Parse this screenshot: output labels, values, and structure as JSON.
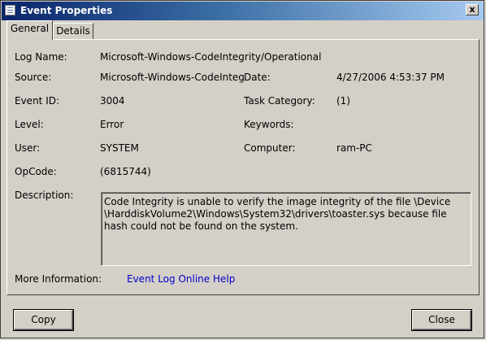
{
  "window": {
    "title": "Event Properties",
    "close_glyph": "x",
    "app_icon": "document-icon"
  },
  "tabs": [
    {
      "label": "General",
      "active": true
    },
    {
      "label": "Details",
      "active": false
    }
  ],
  "general": {
    "log_name_label": "Log Name:",
    "log_name_value": "Microsoft-Windows-CodeIntegrity/Operational",
    "source_label": "Source:",
    "source_value": "Microsoft-Windows-CodeInteg",
    "date_label": "Date:",
    "date_value": "4/27/2006 4:53:37 PM",
    "event_id_label": "Event ID:",
    "event_id_value": "3004",
    "task_category_label": "Task Category:",
    "task_category_value": "(1)",
    "level_label": "Level:",
    "level_value": "Error",
    "keywords_label": "Keywords:",
    "keywords_value": "",
    "user_label": "User:",
    "user_value": "SYSTEM",
    "computer_label": "Computer:",
    "computer_value": "ram-PC",
    "opcode_label": "OpCode:",
    "opcode_value": "(6815744)",
    "description_label": "Description:",
    "description_value": "Code Integrity is unable to verify the image integrity of the file \\Device \\HarddiskVolume2\\Windows\\System32\\drivers\\toaster.sys because file hash could not be found on the system.",
    "more_info_label": "More Information:",
    "more_info_link": "Event Log Online Help"
  },
  "buttons": {
    "copy_label": "Copy",
    "close_label": "Close"
  },
  "colors": {
    "titlebar_start": "#0a246a",
    "titlebar_end": "#a6caf0",
    "face": "#d4d0c8",
    "link": "#0000cc"
  }
}
